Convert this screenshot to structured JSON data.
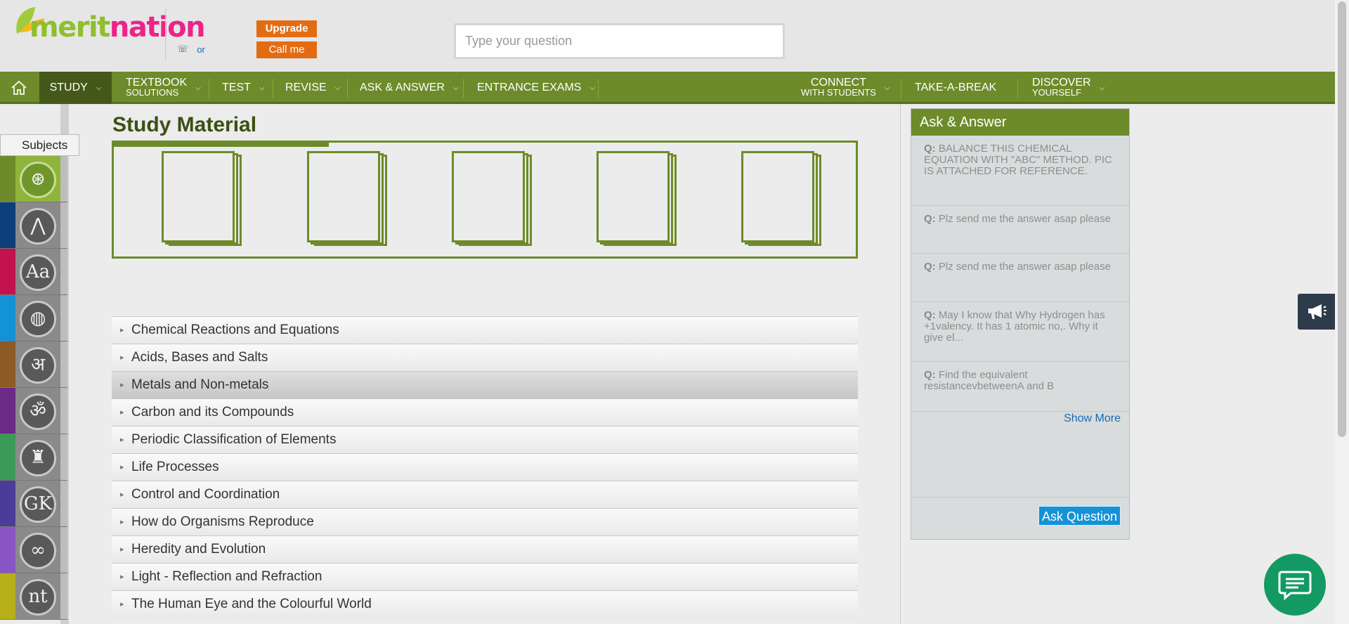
{
  "header": {
    "logo_text": "meritnation",
    "phone_or": "or",
    "upgrade_label": "Upgrade",
    "callme_label": "Call me",
    "search_placeholder": "Type your question"
  },
  "nav": {
    "study": "STUDY",
    "textbook": "TEXTBOOK",
    "textbook_sub": "SOLUTIONS",
    "test": "TEST",
    "revise": "REVISE",
    "ask_answer": "ASK & ANSWER",
    "entrance": "ENTRANCE EXAMS",
    "connect": "CONNECT",
    "connect_sub": "WITH STUDENTS",
    "take_break": "TAKE-A-BREAK",
    "discover": "DISCOVER",
    "discover_sub": "YOURSELF"
  },
  "sidebar": {
    "subjects_label": "Subjects",
    "items": [
      {
        "icon": "atom-icon",
        "glyph": "⊛",
        "color": "#6d8b2a"
      },
      {
        "icon": "compass-icon",
        "glyph": "⋀",
        "color": "#0d3f7a"
      },
      {
        "icon": "english-icon",
        "glyph": "Aa",
        "color": "#c4124e"
      },
      {
        "icon": "globe-icon",
        "glyph": "◍",
        "color": "#1492d6"
      },
      {
        "icon": "hindi-icon",
        "glyph": "अ",
        "color": "#8c5a25"
      },
      {
        "icon": "sanskrit-icon",
        "glyph": "ॐ",
        "color": "#6a2a86"
      },
      {
        "icon": "eiffel-tower-icon",
        "glyph": "♜",
        "color": "#3c9a58"
      },
      {
        "icon": "gk-icon",
        "glyph": "GK",
        "color": "#4b3c9a"
      },
      {
        "icon": "olympic-rings-icon",
        "glyph": "∞",
        "color": "#8a55c4"
      },
      {
        "icon": "ntse-icon",
        "glyph": "nt",
        "color": "#b8b01a"
      }
    ]
  },
  "main": {
    "title": "Study Material",
    "carousel_progress": 0.29,
    "chapters": [
      "Chemical Reactions and Equations",
      "Acids, Bases and Salts",
      "Metals and Non-metals",
      "Carbon and its Compounds",
      "Periodic Classification of Elements",
      "Life Processes",
      "Control and Coordination",
      "How do Organisms Reproduce",
      "Heredity and Evolution",
      "Light - Reflection and Refraction",
      "The Human Eye and the Colourful World"
    ]
  },
  "ask_answer": {
    "title": "Ask & Answer",
    "q_prefix": "Q:",
    "questions": [
      "BALANCE THIS CHEMICAL EQUATION WITH \"ABC\" METHOD. PIC IS ATTACHED FOR REFERENCE.",
      "Plz send me the answer asap please",
      "Plz send me the answer asap please",
      "May I know that Why Hydrogen has +1valency. It has 1 atomic no,. Why it give el...",
      "Find the equivalent resistancevbetweenA and B"
    ],
    "show_more": "Show More",
    "ask_button": "Ask Question"
  },
  "colors": {
    "brand_green": "#6d8b2a",
    "dark_green": "#44581a",
    "orange": "#e36c13",
    "blue": "#1592d6",
    "chat_green": "#129a62"
  }
}
